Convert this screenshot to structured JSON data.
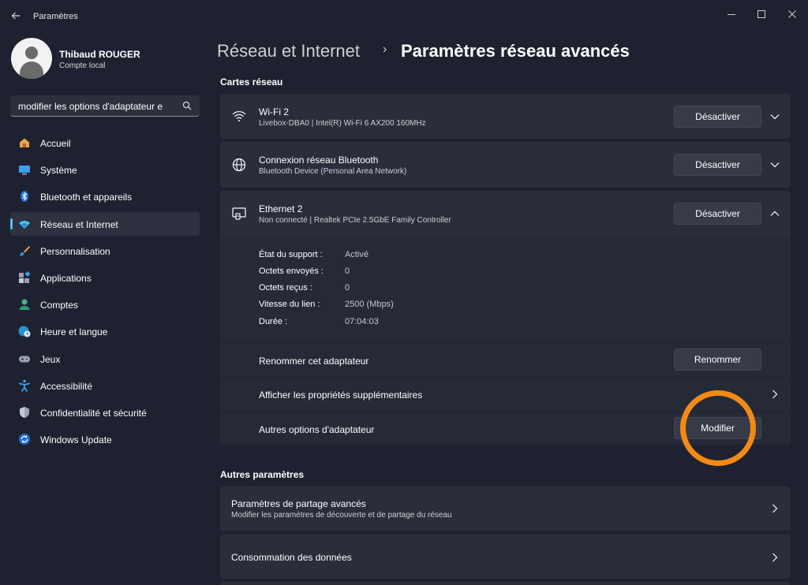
{
  "window": {
    "title": "Paramètres"
  },
  "profile": {
    "name": "Thibaud ROUGER",
    "account_type": "Compte local"
  },
  "search": {
    "value": "modifier les options d'adaptateur e"
  },
  "nav": {
    "items": [
      {
        "label": "Accueil",
        "icon": "home-icon"
      },
      {
        "label": "Système",
        "icon": "system-icon"
      },
      {
        "label": "Bluetooth et appareils",
        "icon": "bluetooth-icon"
      },
      {
        "label": "Réseau et Internet",
        "icon": "network-icon"
      },
      {
        "label": "Personnalisation",
        "icon": "brush-icon"
      },
      {
        "label": "Applications",
        "icon": "apps-icon"
      },
      {
        "label": "Comptes",
        "icon": "accounts-icon"
      },
      {
        "label": "Heure et langue",
        "icon": "globe-clock-icon"
      },
      {
        "label": "Jeux",
        "icon": "gamepad-icon"
      },
      {
        "label": "Accessibilité",
        "icon": "accessibility-icon"
      },
      {
        "label": "Confidentialité et sécurité",
        "icon": "shield-icon"
      },
      {
        "label": "Windows Update",
        "icon": "update-icon"
      }
    ],
    "active": "Réseau et Internet"
  },
  "header": {
    "parent": "Réseau et Internet",
    "separator": "›",
    "current": "Paramètres réseau avancés"
  },
  "sections": {
    "adapters_title": "Cartes réseau",
    "other_title": "Autres paramètres"
  },
  "adapters": [
    {
      "name": "Wi-Fi 2",
      "detail": "Livebox-DBA0 | Intel(R) Wi-Fi 6 AX200 160MHz",
      "button": "Désactiver",
      "icon": "wifi-icon"
    },
    {
      "name": "Connexion réseau Bluetooth",
      "detail": "Bluetooth Device (Personal Area Network)",
      "button": "Désactiver",
      "icon": "globe-icon"
    },
    {
      "name": "Ethernet 2",
      "detail": "Non connecté | Realtek PCIe 2.5GbE Family Controller",
      "button": "Désactiver",
      "icon": "ethernet-icon"
    }
  ],
  "ethernet_details": {
    "properties": [
      {
        "label": "État du support :",
        "value": "Activé"
      },
      {
        "label": "Octets envoyés :",
        "value": "0"
      },
      {
        "label": "Octets reçus :",
        "value": "0"
      },
      {
        "label": "Vitesse du lien :",
        "value": "2500 (Mbps)"
      },
      {
        "label": "Durée :",
        "value": "07:04:03"
      }
    ],
    "rename_label": "Renommer cet adaptateur",
    "rename_button": "Renommer",
    "more_props_label": "Afficher les propriétés supplémentaires",
    "other_options_label": "Autres options d'adaptateur",
    "modify_button": "Modifier"
  },
  "other_settings": [
    {
      "title": "Paramètres de partage avancés",
      "subtitle": "Modifier les paramètres de découverte et de partage du réseau"
    },
    {
      "title": "Consommation des données",
      "subtitle": ""
    }
  ],
  "colors": {
    "accent": "#4cc2ff",
    "highlight": "#f28a16"
  }
}
